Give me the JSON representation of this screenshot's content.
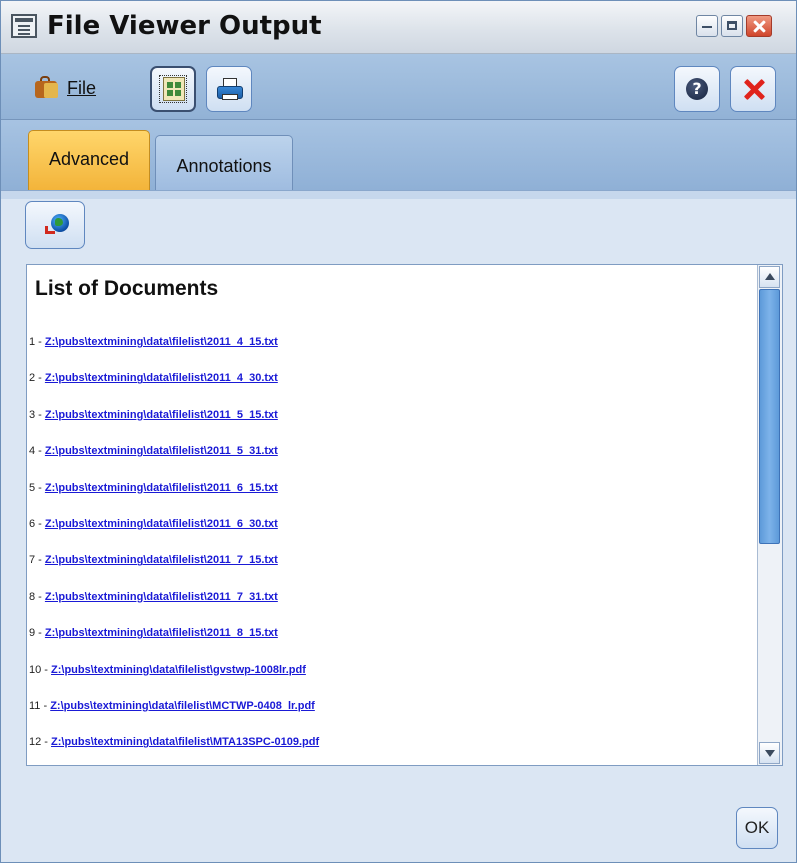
{
  "window": {
    "title": "File Viewer Output",
    "buttons": [
      "minimize",
      "maximize",
      "close"
    ]
  },
  "toolbar": {
    "file_menu_label": "File",
    "buttons": [
      "export",
      "print",
      "help",
      "close"
    ]
  },
  "tabs": [
    {
      "label": "Advanced",
      "active": true
    },
    {
      "label": "Annotations",
      "active": false
    }
  ],
  "content": {
    "heading": "List of Documents",
    "documents": [
      {
        "num": "1 - ",
        "path": "Z:\\pubs\\textmining\\data\\filelist\\2011_4_15.txt"
      },
      {
        "num": "2 - ",
        "path": "Z:\\pubs\\textmining\\data\\filelist\\2011_4_30.txt"
      },
      {
        "num": "3 - ",
        "path": "Z:\\pubs\\textmining\\data\\filelist\\2011_5_15.txt"
      },
      {
        "num": "4 - ",
        "path": "Z:\\pubs\\textmining\\data\\filelist\\2011_5_31.txt"
      },
      {
        "num": "5 - ",
        "path": "Z:\\pubs\\textmining\\data\\filelist\\2011_6_15.txt"
      },
      {
        "num": "6 - ",
        "path": "Z:\\pubs\\textmining\\data\\filelist\\2011_6_30.txt"
      },
      {
        "num": "7 - ",
        "path": "Z:\\pubs\\textmining\\data\\filelist\\2011_7_15.txt"
      },
      {
        "num": "8 - ",
        "path": "Z:\\pubs\\textmining\\data\\filelist\\2011_7_31.txt"
      },
      {
        "num": "9 - ",
        "path": "Z:\\pubs\\textmining\\data\\filelist\\2011_8_15.txt"
      },
      {
        "num": "10 - ",
        "path": "Z:\\pubs\\textmining\\data\\filelist\\gvstwp-1008lr.pdf"
      },
      {
        "num": "11 - ",
        "path": "Z:\\pubs\\textmining\\data\\filelist\\MCTWP-0408_lr.pdf"
      },
      {
        "num": "12 - ",
        "path": "Z:\\pubs\\textmining\\data\\filelist\\MTA13SPC-0109.pdf"
      }
    ]
  },
  "footer": {
    "ok_label": "OK"
  },
  "colors": {
    "active_tab": "#f3b43a",
    "link": "#1a1ad6",
    "toolbar_bg": "#9ab8db"
  }
}
